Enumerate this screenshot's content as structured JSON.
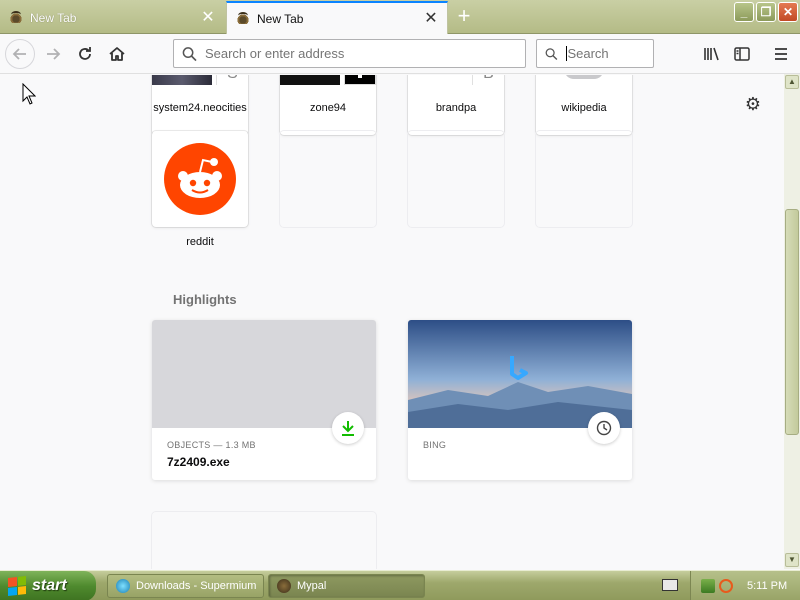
{
  "window": {
    "tabs": [
      {
        "title": "New Tab",
        "state": "inactive"
      },
      {
        "title": "New Tab",
        "state": "active"
      }
    ],
    "new_tab_symbol": "+",
    "controls": {
      "minimize": "_",
      "restore": "❐",
      "close": "✕"
    }
  },
  "toolbar": {
    "address_placeholder": "Search or enter address",
    "search_placeholder": "Search"
  },
  "top_sites": [
    {
      "label": "system24.neocities",
      "letter": "S"
    },
    {
      "label": "zone94"
    },
    {
      "label": "brandpa",
      "letter": "B"
    },
    {
      "label": "wikipedia"
    },
    {
      "label": "reddit"
    }
  ],
  "highlights": {
    "title": "Highlights",
    "cards": [
      {
        "context": "OBJECTS — 1.3 MB",
        "name": "7z2409.exe",
        "badge_icon": "download-icon"
      },
      {
        "context": "BING",
        "name": "",
        "badge_icon": "clock-icon"
      }
    ]
  },
  "taskbar": {
    "start_label": "start",
    "items": [
      {
        "label": "Downloads - Supermium"
      },
      {
        "label": "Mypal"
      }
    ],
    "clock": "5:11 PM"
  },
  "colors": {
    "accent": "#0a84ff",
    "reddit": "#ff4500",
    "download_green": "#12bc00",
    "theme_olive": "#b4bb86"
  }
}
